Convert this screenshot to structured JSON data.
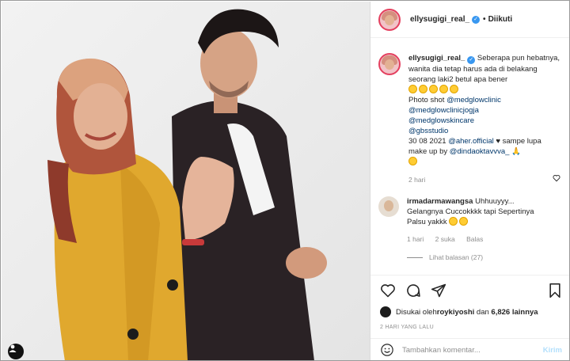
{
  "post": {
    "author": "ellysugigi_real_",
    "follow_separator": "•",
    "follow_label": "Diikuti",
    "caption": {
      "line1": " Seberapa pun hebatnya, wanita dia tetap harus ada di belakang seorang laki2 betul apa bener",
      "emoji_count": 5,
      "photo_shot": "Photo shot ",
      "tags": [
        "@medglowclinic",
        "@medglowclinicjogja",
        "@medglowskincare",
        "@gbsstudio"
      ],
      "date_text": "30 08 2021 ",
      "aher": "@aher.official",
      "heart": " ♥ sampe lupa make up by ",
      "dinda": "@dindaoktavvva_",
      "tail": " 🙏"
    },
    "caption_age": "2 hari"
  },
  "comment": {
    "author": "irmadarmawangsa",
    "text": " Uhhuuyyy... Gelangnya Cuccokkkk tapi Sepertinya Palsu yakkk",
    "emoji_count": 2,
    "age": "1 hari",
    "likes": "2 suka",
    "reply": "Balas",
    "view_replies": "Lihat balasan (27)"
  },
  "likes": {
    "prefix": "Disukai oleh ",
    "user": "roykiyoshi",
    "middle": " dan ",
    "count": "6,826 lainnya"
  },
  "posted": "2 HARI YANG LALU",
  "composer": {
    "placeholder": "Tambahkan komentar...",
    "send_label": "Kirim"
  },
  "colors": {
    "verified": "#3897f0",
    "link": "#00376b",
    "muted": "#8e8e8e",
    "send_disabled": "#b2dffc",
    "coat": "#e0a82e",
    "jacket": "#2a2225"
  },
  "icons": [
    "user-tag-icon",
    "verified-icon",
    "heart-icon",
    "comment-icon",
    "share-icon",
    "bookmark-icon",
    "emoji-icon"
  ]
}
